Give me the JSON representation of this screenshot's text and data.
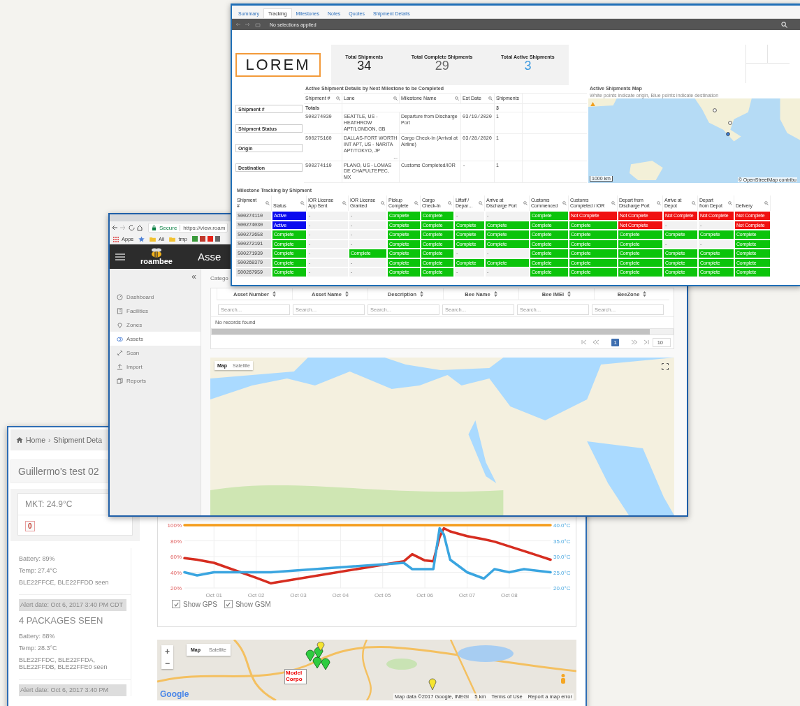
{
  "shipment_window": {
    "breadcrumb": {
      "items": [
        "Home",
        "Shipment Deta"
      ],
      "separator": "›"
    },
    "title": "Guillermo's test 02",
    "mkt": "MKT: 24.9°C",
    "alert_count": "0",
    "feed": [
      {
        "kind": "reading",
        "lines": [
          "Battery: 89%",
          "Temp: 27.4°C",
          "BLE22FFCE, BLE22FFDD seen"
        ]
      },
      {
        "kind": "alert",
        "text": "Alert date:  Oct 6, 2017 3:40 PM CDT"
      },
      {
        "kind": "heading",
        "text": "4 PACKAGES SEEN"
      },
      {
        "kind": "reading",
        "lines": [
          "Battery: 88%",
          "Temp: 28.3°C",
          "BLE22FFDC, BLE22FFDA, BLE22FFDB, BLE22FFE0 seen"
        ]
      },
      {
        "kind": "alert",
        "text": "Alert date:  Oct 6, 2017 3:40 PM"
      }
    ],
    "chart": {
      "chart_data": {
        "type": "line",
        "grid": true,
        "x": [
          "2017-09-30T07:12",
          "2017-09-30T14:24",
          "2017-10-01T00:00",
          "2017-10-02T00:00",
          "2017-10-02T08:24",
          "2017-10-05T12:00",
          "2017-10-05T16:48",
          "2017-10-06T00:00",
          "2017-10-06T04:48",
          "2017-10-06T08:24",
          "2017-10-06T10:48",
          "2017-10-06T14:24",
          "2017-10-07T00:00",
          "2017-10-07T09:36",
          "2017-10-07T15:36",
          "2017-10-08T00:00",
          "2017-10-08T08:24",
          "2017-10-08T23:31"
        ],
        "xlim": [
          "2017-09-30T07:12",
          "2017-10-08T23:31"
        ],
        "ylim": [
          20,
          100
        ],
        "y2lim": [
          20,
          40
        ],
        "xticks": [
          {
            "value": "2017-10-01T00:00",
            "label": "Oct 01"
          },
          {
            "value": "2017-10-02T00:00",
            "label": "Oct 02"
          },
          {
            "value": "2017-10-03T00:00",
            "label": "Oct 03"
          },
          {
            "value": "2017-10-04T00:00",
            "label": "Oct 04"
          },
          {
            "value": "2017-10-05T00:00",
            "label": "Oct 05"
          },
          {
            "value": "2017-10-06T00:00",
            "label": "Oct 06"
          },
          {
            "value": "2017-10-07T00:00",
            "label": "Oct 07"
          },
          {
            "value": "2017-10-08T00:00",
            "label": "Oct 08"
          }
        ],
        "yticks": [
          {
            "value": 20,
            "label": "20%"
          },
          {
            "value": 40,
            "label": "40%"
          },
          {
            "value": 60,
            "label": "60%"
          },
          {
            "value": 80,
            "label": "80%"
          },
          {
            "value": 100,
            "label": "100%"
          }
        ],
        "y2ticks": [
          {
            "value": 20,
            "label": "20.0°C"
          },
          {
            "value": 25,
            "label": "25.0°C"
          },
          {
            "value": 30,
            "label": "30.0°C"
          },
          {
            "value": 35,
            "label": "35.0°C"
          },
          {
            "value": 40,
            "label": "40.0°C"
          }
        ],
        "series": [
          {
            "color": "#f59c1a",
            "values": [
              100,
              100,
              100,
              100,
              100,
              100,
              100,
              100,
              100,
              100,
              100,
              100,
              100,
              100,
              100,
              100,
              100,
              100
            ]
          },
          {
            "color": "#d62d20",
            "values": [
              58,
              56,
              52,
              33,
              26,
              54,
              63,
              55,
              54,
              85,
              96,
              92,
              86,
              82,
              79,
              73,
              67,
              56
            ]
          },
          {
            "color": "#3aa5e0",
            "axis": "y2",
            "values": [
              25,
              24,
              25,
              25,
              25,
              28,
              26,
              26,
              26,
              39,
              37,
              29,
              25,
              23,
              26,
              25,
              26,
              25
            ]
          }
        ]
      }
    },
    "toggles": [
      {
        "label": "Show GPS",
        "checked": true
      },
      {
        "label": "Show GSM",
        "checked": true
      }
    ],
    "map": {
      "modes": [
        {
          "label": "Map",
          "selected": true
        },
        {
          "label": "Satellite",
          "selected": false
        }
      ],
      "zoom": [
        "+",
        "−"
      ],
      "marker_label": "Model Corpo",
      "logo": "Google",
      "attribution": [
        "Map data ©2017 Google, INEGI",
        "5 km",
        "Terms of Use",
        "Report a map error"
      ]
    }
  },
  "assets_window": {
    "security": "Secure",
    "url": "https://view.roam",
    "bookmarks": [
      "Apps",
      "All",
      "tmp"
    ],
    "logo": "roambee",
    "page_title": "Asse",
    "collapse": "«",
    "sidebar": [
      {
        "label": "Dashboard",
        "selected": false
      },
      {
        "label": "Facilities",
        "selected": false
      },
      {
        "label": "Zones",
        "selected": false
      },
      {
        "label": "Assets",
        "selected": true
      },
      {
        "label": "Scan",
        "selected": false
      },
      {
        "label": "Import",
        "selected": false
      },
      {
        "label": "Reports",
        "selected": false
      }
    ],
    "category_label": "Catego",
    "columns": [
      {
        "label": "Asset Number",
        "placeholder": "Search..."
      },
      {
        "label": "Asset Name",
        "placeholder": "Search..."
      },
      {
        "label": "Description",
        "placeholder": "Search..."
      },
      {
        "label": "Bee Name",
        "placeholder": "Search..."
      },
      {
        "label": "Bee IMEI",
        "placeholder": "Search..."
      },
      {
        "label": "BeeZone",
        "placeholder": "Search..."
      }
    ],
    "empty_message": "No records found",
    "pages": [
      {
        "label": "1",
        "selected": true
      }
    ],
    "page_size": "10",
    "map": {
      "modes": [
        {
          "label": "Map",
          "selected": true
        },
        {
          "label": "Satellite",
          "selected": false
        }
      ]
    }
  },
  "tracking_window": {
    "tabs": [
      {
        "label": "Summary",
        "selected": false
      },
      {
        "label": "Tracking",
        "selected": true
      },
      {
        "label": "Milestones",
        "selected": false
      },
      {
        "label": "Notes",
        "selected": false
      },
      {
        "label": "Quotes",
        "selected": false
      },
      {
        "label": "Shipment Details",
        "selected": false
      }
    ],
    "selection_status": "No selections applied",
    "logo": "LOREM",
    "kpis": [
      {
        "label": "Total Shipments",
        "value": "34",
        "kind": "dark"
      },
      {
        "label": "Total Complete Shipments",
        "value": "29",
        "kind": "muted"
      },
      {
        "label": "Total Active Shipments",
        "value": "3",
        "kind": "accent"
      }
    ],
    "filters": [
      "Shipment #",
      "Shipment Status",
      "Origin",
      "Destination"
    ],
    "details": {
      "title": "Active Shipment Details by Next Milestone to be Completed",
      "columns": [
        {
          "label": "Shipment #",
          "searchable": true
        },
        {
          "label": "Lane",
          "searchable": true
        },
        {
          "label": "Milestone Name",
          "searchable": true
        },
        {
          "label": "Est Date",
          "searchable": true
        },
        {
          "label": "Shipments",
          "searchable": false
        }
      ],
      "totals": {
        "label": "Totals",
        "shipments": "3"
      },
      "rows": [
        {
          "shipment": "S00274030",
          "lane": "SEATTLE, US - HEATHROW APT/LONDON, GB",
          "milestone": "Departure from Discharge Port",
          "est_date": "03/19/2020",
          "shipments": "1"
        },
        {
          "shipment": "S00275160",
          "lane": "DALLAS-FORT WORTH INT APT, US - NARITA APT/TOKYO, JP",
          "more": "...",
          "milestone": "Cargo Check-In (Arrival at Airline)",
          "est_date": "03/28/2020",
          "shipments": "1"
        },
        {
          "shipment": "S00274110",
          "lane": "PLANO, US - LOMAS DE CHAPULTEPEC, MX",
          "milestone": "Customs Completed/IOR",
          "est_date": "-",
          "shipments": "1"
        }
      ]
    },
    "map": {
      "title": "Active Shipments Map",
      "subtitle": "White points indicate origin, Blue points indicate destination",
      "scale": "1000 km",
      "attribution": "© OpenStreetMap contribu"
    },
    "milestones": {
      "title": "Milestone Tracking by Shipment",
      "columns": [
        "Shipment\n#",
        "Status",
        "IOR License\nApp Sent",
        "IOR License\nGranted",
        "Pickup\nComplete",
        "Cargo\nCheck-In",
        "Liftoff /\nDepar…",
        "Arrive at\nDischarge Port",
        "Customs\nCommenced",
        "Customs\nCompleted / IOR",
        "Depart from\nDischarge Port",
        "Arrive at\nDepot",
        "Depart\nfrom Depot",
        "Delivery"
      ],
      "rows": [
        {
          "cells": [
            {
              "text": "S00274110",
              "kind": "id"
            },
            {
              "text": "Active",
              "kind": "active"
            },
            {
              "text": "-",
              "kind": "none"
            },
            {
              "text": "-",
              "kind": "none"
            },
            {
              "text": "Complete",
              "kind": "complete"
            },
            {
              "text": "Complete",
              "kind": "complete"
            },
            {
              "text": "-",
              "kind": "none"
            },
            {
              "text": "-",
              "kind": "none"
            },
            {
              "text": "Complete",
              "kind": "complete"
            },
            {
              "text": "Not Complete",
              "kind": "not_complete"
            },
            {
              "text": "Not Complete",
              "kind": "not_complete"
            },
            {
              "text": "Not Complete",
              "kind": "not_complete"
            },
            {
              "text": "Not Complete",
              "kind": "not_complete"
            },
            {
              "text": "Not Complete",
              "kind": "not_complete"
            }
          ]
        },
        {
          "cells": [
            {
              "text": "S00274030",
              "kind": "id"
            },
            {
              "text": "Active",
              "kind": "active"
            },
            {
              "text": "-",
              "kind": "none"
            },
            {
              "text": "-",
              "kind": "none"
            },
            {
              "text": "Complete",
              "kind": "complete"
            },
            {
              "text": "Complete",
              "kind": "complete"
            },
            {
              "text": "Complete",
              "kind": "complete"
            },
            {
              "text": "Complete",
              "kind": "complete"
            },
            {
              "text": "Complete",
              "kind": "complete"
            },
            {
              "text": "Complete",
              "kind": "complete"
            },
            {
              "text": "Not Complete",
              "kind": "not_complete"
            },
            {
              "text": "-",
              "kind": "none"
            },
            {
              "text": "-",
              "kind": "none"
            },
            {
              "text": "Not Complete",
              "kind": "not_complete"
            }
          ]
        },
        {
          "cells": [
            {
              "text": "S00272658",
              "kind": "id"
            },
            {
              "text": "Complete",
              "kind": "complete"
            },
            {
              "text": "-",
              "kind": "none"
            },
            {
              "text": "-",
              "kind": "none"
            },
            {
              "text": "Complete",
              "kind": "complete"
            },
            {
              "text": "Complete",
              "kind": "complete"
            },
            {
              "text": "Complete",
              "kind": "complete"
            },
            {
              "text": "Complete",
              "kind": "complete"
            },
            {
              "text": "Complete",
              "kind": "complete"
            },
            {
              "text": "Complete",
              "kind": "complete"
            },
            {
              "text": "Complete",
              "kind": "complete"
            },
            {
              "text": "Complete",
              "kind": "complete"
            },
            {
              "text": "Complete",
              "kind": "complete"
            },
            {
              "text": "Complete",
              "kind": "complete"
            }
          ]
        },
        {
          "cells": [
            {
              "text": "S00272191",
              "kind": "id"
            },
            {
              "text": "Complete",
              "kind": "complete"
            },
            {
              "text": "-",
              "kind": "none"
            },
            {
              "text": "-",
              "kind": "none"
            },
            {
              "text": "Complete",
              "kind": "complete"
            },
            {
              "text": "Complete",
              "kind": "complete"
            },
            {
              "text": "Complete",
              "kind": "complete"
            },
            {
              "text": "Complete",
              "kind": "complete"
            },
            {
              "text": "Complete",
              "kind": "complete"
            },
            {
              "text": "Complete",
              "kind": "complete"
            },
            {
              "text": "Complete",
              "kind": "complete"
            },
            {
              "text": "-",
              "kind": "none"
            },
            {
              "text": "-",
              "kind": "none"
            },
            {
              "text": "Complete",
              "kind": "complete"
            }
          ]
        },
        {
          "cells": [
            {
              "text": "S00271939",
              "kind": "id"
            },
            {
              "text": "Complete",
              "kind": "complete"
            },
            {
              "text": "-",
              "kind": "none"
            },
            {
              "text": "Complete",
              "kind": "complete"
            },
            {
              "text": "Complete",
              "kind": "complete"
            },
            {
              "text": "Complete",
              "kind": "complete"
            },
            {
              "text": "-",
              "kind": "none"
            },
            {
              "text": "-",
              "kind": "none"
            },
            {
              "text": "Complete",
              "kind": "complete"
            },
            {
              "text": "Complete",
              "kind": "complete"
            },
            {
              "text": "Complete",
              "kind": "complete"
            },
            {
              "text": "Complete",
              "kind": "complete"
            },
            {
              "text": "Complete",
              "kind": "complete"
            },
            {
              "text": "Complete",
              "kind": "complete"
            }
          ]
        },
        {
          "cells": [
            {
              "text": "S00268379",
              "kind": "id"
            },
            {
              "text": "Complete",
              "kind": "complete"
            },
            {
              "text": "-",
              "kind": "none"
            },
            {
              "text": "-",
              "kind": "none"
            },
            {
              "text": "Complete",
              "kind": "complete"
            },
            {
              "text": "Complete",
              "kind": "complete"
            },
            {
              "text": "Complete",
              "kind": "complete"
            },
            {
              "text": "Complete",
              "kind": "complete"
            },
            {
              "text": "Complete",
              "kind": "complete"
            },
            {
              "text": "Complete",
              "kind": "complete"
            },
            {
              "text": "Complete",
              "kind": "complete"
            },
            {
              "text": "Complete",
              "kind": "complete"
            },
            {
              "text": "Complete",
              "kind": "complete"
            },
            {
              "text": "Complete",
              "kind": "complete"
            }
          ]
        },
        {
          "cells": [
            {
              "text": "S00267959",
              "kind": "id"
            },
            {
              "text": "Complete",
              "kind": "complete"
            },
            {
              "text": "-",
              "kind": "none"
            },
            {
              "text": "-",
              "kind": "none"
            },
            {
              "text": "Complete",
              "kind": "complete"
            },
            {
              "text": "Complete",
              "kind": "complete"
            },
            {
              "text": "-",
              "kind": "none"
            },
            {
              "text": "-",
              "kind": "none"
            },
            {
              "text": "Complete",
              "kind": "complete"
            },
            {
              "text": "Complete",
              "kind": "complete"
            },
            {
              "text": "Complete",
              "kind": "complete"
            },
            {
              "text": "Complete",
              "kind": "complete"
            },
            {
              "text": "Complete",
              "kind": "complete"
            },
            {
              "text": "Complete",
              "kind": "complete"
            }
          ]
        }
      ]
    }
  }
}
